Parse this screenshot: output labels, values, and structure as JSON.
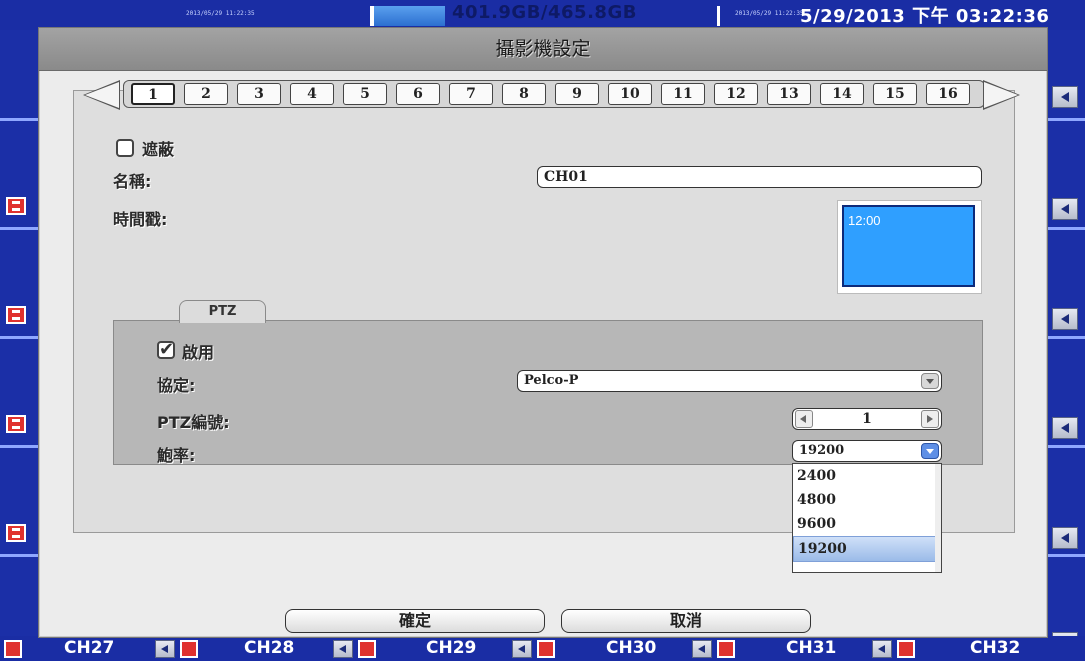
{
  "status_bar": {
    "left_timestamp": "2013/05/29 11:22:35",
    "storage": "401.9GB/465.8GB",
    "right_timestamp_small": "2013/05/29 11:22:35",
    "datetime": "5/29/2013 下午 03:22:36"
  },
  "dialog": {
    "title": "攝影機設定",
    "channel_tabs": [
      "1",
      "2",
      "3",
      "4",
      "5",
      "6",
      "7",
      "8",
      "9",
      "10",
      "11",
      "12",
      "13",
      "14",
      "15",
      "16"
    ],
    "active_channel": "1",
    "mask_label": "遮蔽",
    "name_label": "名稱:",
    "name_value": "CH01",
    "timestamp_label": "時間戳:",
    "timestamp_preview": "12:00",
    "ptz": {
      "tab_label": "PTZ",
      "enable_label": "啟用",
      "protocol_label": "協定:",
      "protocol_value": "Pelco-P",
      "ptz_id_label": "PTZ編號:",
      "ptz_id_value": "1",
      "baud_label": "鮑率:",
      "baud_value": "19200",
      "baud_options": [
        "2400",
        "4800",
        "9600",
        "19200"
      ]
    },
    "ok_label": "確定",
    "cancel_label": "取消"
  },
  "channels_bottom": [
    "CH27",
    "CH28",
    "CH29",
    "CH30",
    "CH31",
    "CH32"
  ],
  "colors": {
    "background_blue": "#1b2fa7",
    "dialog_gray": "#ececec",
    "titlebar_gray": "#9a9a9a",
    "preview_blue": "#2f9fff",
    "record_red": "#e0322f"
  }
}
